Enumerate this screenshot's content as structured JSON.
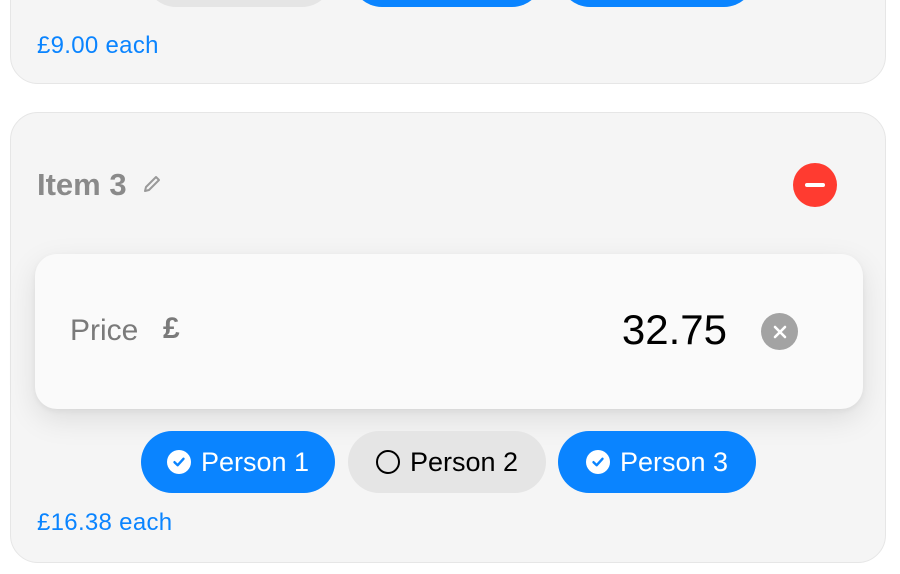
{
  "previous_item": {
    "each_label": "£9.00 each"
  },
  "item": {
    "title": "Item 3",
    "price_label": "Price",
    "currency_symbol": "£",
    "price_value": "32.75",
    "each_label": "£16.38 each",
    "people": [
      {
        "label": "Person 1",
        "selected": true
      },
      {
        "label": "Person 2",
        "selected": false
      },
      {
        "label": "Person 3",
        "selected": true
      }
    ]
  },
  "colors": {
    "accent": "#0a84ff",
    "remove": "#ff3b30",
    "chip_off": "#e5e5e5"
  },
  "icons": {
    "edit": "pencil-icon",
    "remove": "minus-circle-icon",
    "clear": "clear-x-icon",
    "selected": "checkmark-circle-icon",
    "unselected": "empty-circle-icon"
  }
}
